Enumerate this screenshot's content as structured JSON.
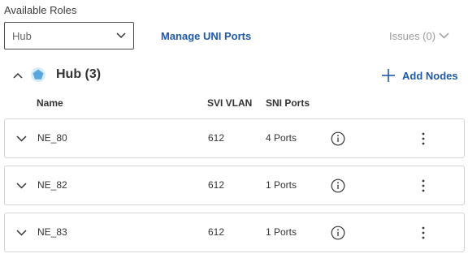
{
  "roles": {
    "label": "Available Roles",
    "selected": "Hub"
  },
  "toolbar": {
    "manage_uni_ports": "Manage UNI Ports",
    "issues": "Issues (0)"
  },
  "group": {
    "title": "Hub (3)",
    "add_nodes": "Add Nodes"
  },
  "columns": {
    "name": "Name",
    "svi_vlan": "SVI VLAN",
    "sni_ports": "SNI Ports"
  },
  "rows": [
    {
      "name": "NE_80",
      "svi_vlan": "612",
      "sni_ports": "4 Ports"
    },
    {
      "name": "NE_82",
      "svi_vlan": "612",
      "sni_ports": "1 Ports"
    },
    {
      "name": "NE_83",
      "svi_vlan": "612",
      "sni_ports": "1 Ports"
    }
  ],
  "colors": {
    "link": "#1e5aa8",
    "hub_icon": "#5aa7e0",
    "border": "#d3d3d3"
  },
  "icons": [
    "chevron-down-icon",
    "chevron-up-icon",
    "hub-icon",
    "plus-icon",
    "info-icon",
    "kebab-menu-icon"
  ]
}
